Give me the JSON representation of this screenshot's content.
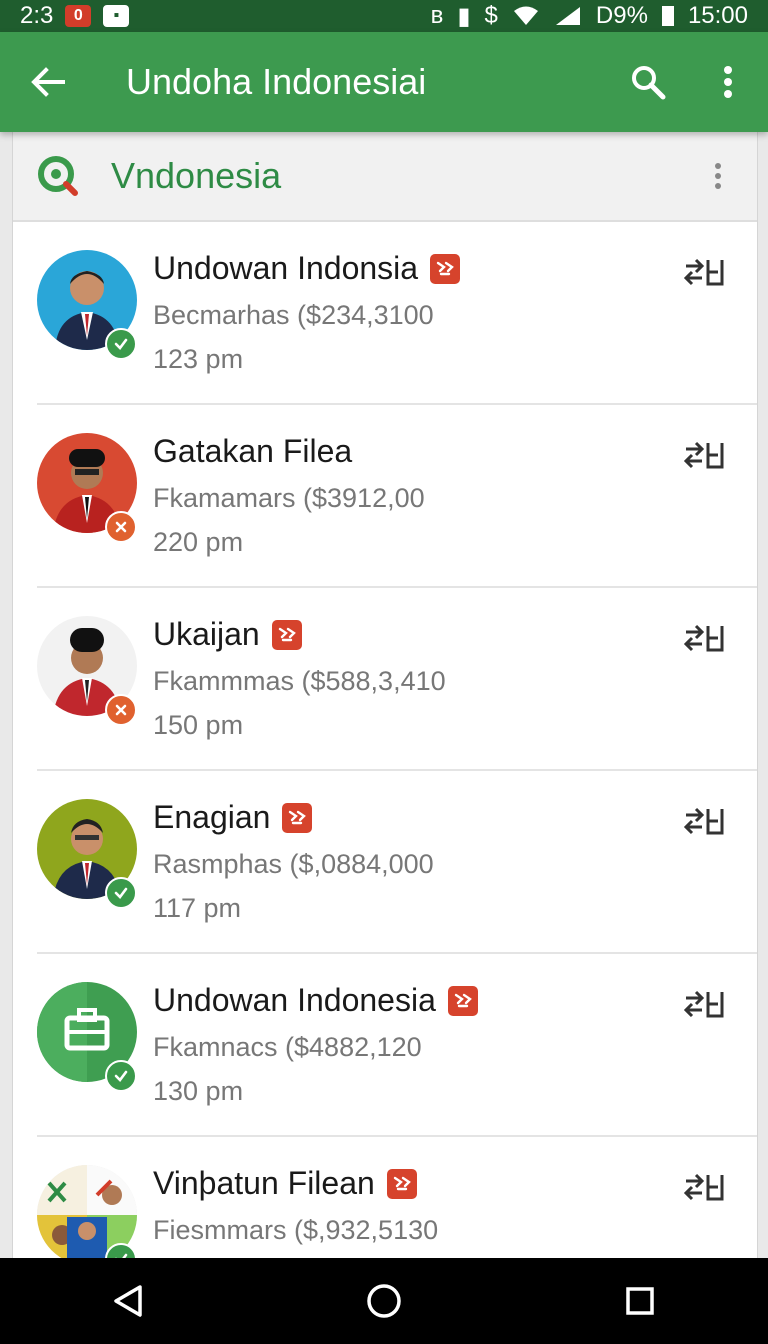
{
  "status_bar": {
    "time_left": "2:3",
    "notif_badge_a": "0",
    "battery_pct": "D9%",
    "clock": "15:00"
  },
  "app_bar": {
    "title": "Undoha Indonesiai"
  },
  "subheader": {
    "title": "Vndonesia"
  },
  "colors": {
    "primary": "#3d9a4f",
    "primary_dark": "#1f5d2e",
    "accent_text": "#2e8b45",
    "tag_red": "#d6432c",
    "ok_green": "#3a9a4b",
    "err_orange": "#e0612f"
  },
  "rows": [
    {
      "name": "Undowan Indonsia",
      "has_tag": true,
      "amount": "Becmarhas ($234,3100",
      "time": "123 pm",
      "status": "ok",
      "avatar_bg": "#2aa6d8",
      "avatar_kind": "person-blue"
    },
    {
      "name": "Gatakan Filea",
      "has_tag": false,
      "amount": "Fkamamars ($3912,00",
      "time": "220 pm",
      "status": "err",
      "avatar_bg": "#d84a32",
      "avatar_kind": "person-red"
    },
    {
      "name": "Ukaijan",
      "has_tag": true,
      "amount": "Fkammmas ($588,3,410",
      "time": "150 pm",
      "status": "err",
      "avatar_bg": "#f2f2f2",
      "avatar_kind": "person-white"
    },
    {
      "name": "Enagian",
      "has_tag": true,
      "amount": "Rasmphas ($,0884,000",
      "time": "117 pm",
      "status": "ok",
      "avatar_bg": "#8fa61d",
      "avatar_kind": "person-olive"
    },
    {
      "name": "Undowan Indonesia",
      "has_tag": true,
      "amount": "Fkamnacs ($4882,120",
      "time": "130 pm",
      "status": "ok",
      "avatar_bg": "#3f9e51",
      "avatar_kind": "briefcase"
    },
    {
      "name": "Vinþatun Filean",
      "has_tag": true,
      "amount": "Fiesmmars ($,932,5130",
      "time": "",
      "status": "ok",
      "avatar_bg": "#e8e8e8",
      "avatar_kind": "collage"
    }
  ],
  "icons": {
    "back": "arrow-back-icon",
    "search": "search-icon",
    "more": "more-vert-icon",
    "row_action": "transfer-icon",
    "tag": "flag-icon",
    "nav": [
      "nav-back-icon",
      "nav-home-icon",
      "nav-recents-icon"
    ]
  }
}
